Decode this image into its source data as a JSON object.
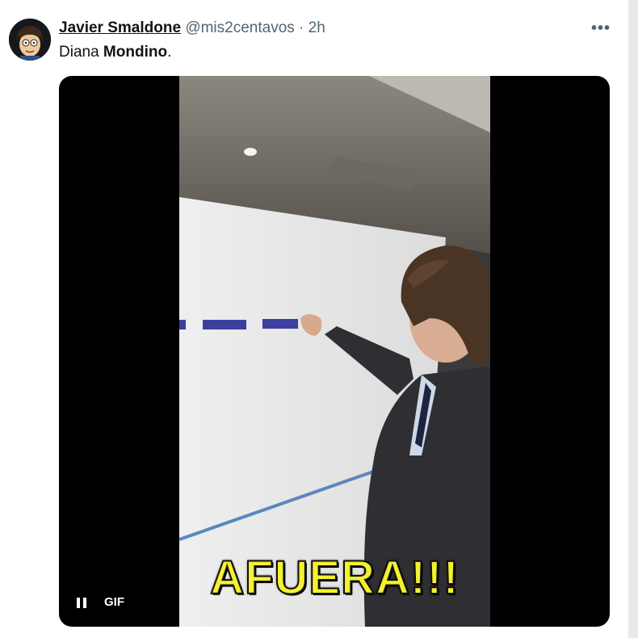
{
  "tweet": {
    "author_name": "Javier Smaldone",
    "author_handle": "@mis2centavos",
    "separator": "·",
    "time": "2h",
    "more_icon": "more-horizontal-icon",
    "text_plain": "Diana ",
    "text_bold": "Mondino",
    "text_end": "."
  },
  "media": {
    "caption": "AFUERA!!!",
    "badge": "GIF",
    "pause_icon": "pause-icon"
  },
  "colors": {
    "caption": "#f4f12e",
    "text_primary": "#0f1419",
    "text_secondary": "#536471"
  }
}
